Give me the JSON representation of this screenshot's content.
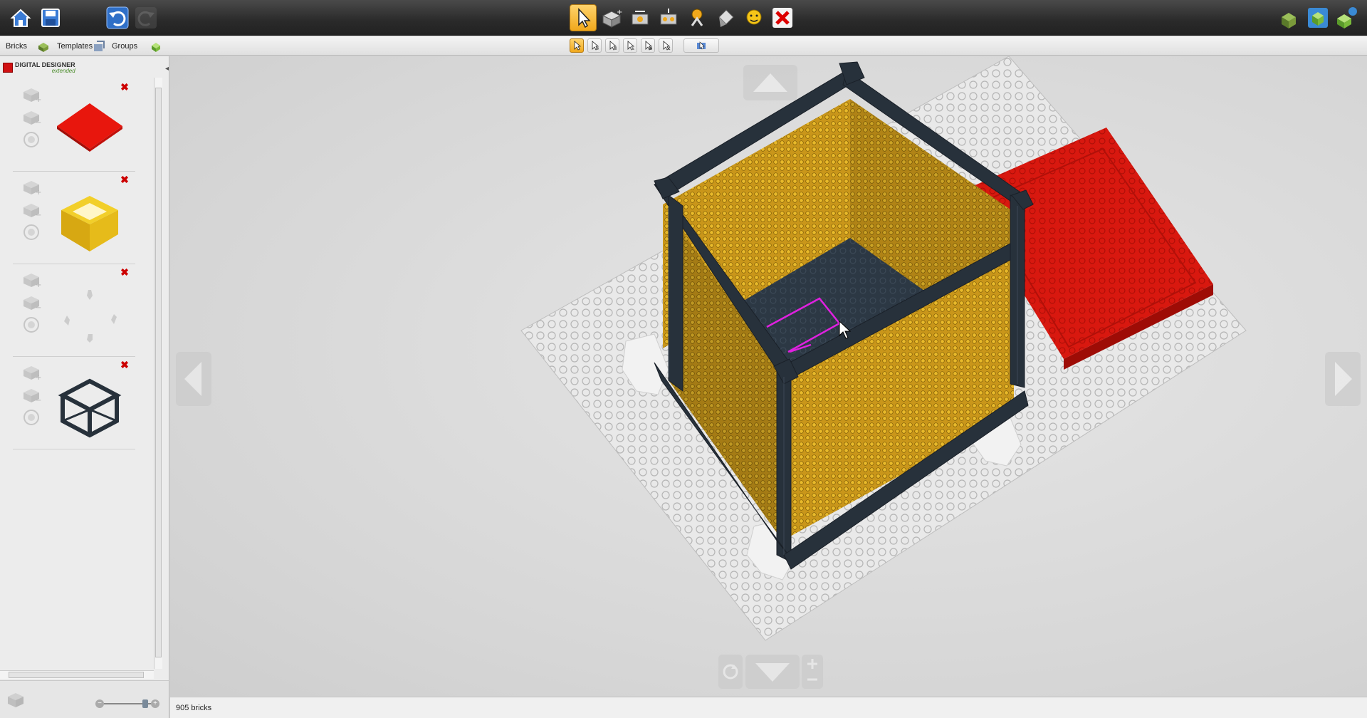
{
  "tabs": [
    {
      "label": "Bricks"
    },
    {
      "label": "Templates"
    },
    {
      "label": "Groups"
    }
  ],
  "logo": {
    "title": "DIGITAL DESIGNER",
    "subtitle": "extended"
  },
  "groups": [
    {
      "thumb": "red-plate-thumbnail"
    },
    {
      "thumb": "yellow-box-thumbnail"
    },
    {
      "thumb": "white-pieces-thumbnail"
    },
    {
      "thumb": "dark-frame-thumbnail"
    }
  ],
  "status": {
    "brick_count": "905 bricks"
  },
  "colors": {
    "active_tool": "#f0a81c",
    "plate_red": "#d8180f",
    "wall_yellow": "#c9961a",
    "frame_dark": "#27313b",
    "baseplate": "#e8e8e8",
    "delete_red": "#cc0000"
  }
}
